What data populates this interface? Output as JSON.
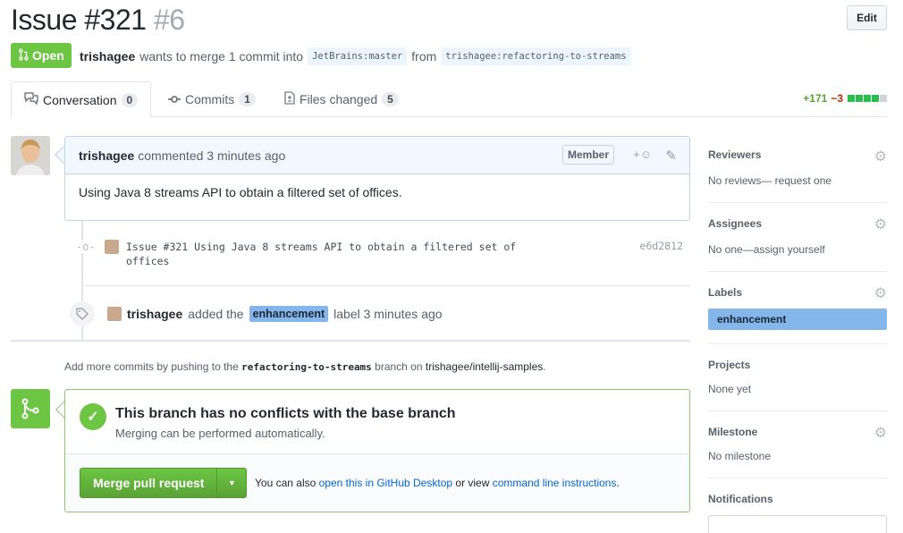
{
  "header": {
    "title": "Issue #321",
    "number": "#6",
    "edit_label": "Edit",
    "state_label": "Open",
    "author": "trishagee",
    "merge_text": "wants to merge 1 commit into",
    "base_ref": "JetBrains:master",
    "from_text": "from",
    "head_ref": "trishagee:refactoring-to-streams"
  },
  "tabs": [
    {
      "label": "Conversation",
      "count": "0",
      "icon": "comment-discussion-icon"
    },
    {
      "label": "Commits",
      "count": "1",
      "icon": "git-commit-icon"
    },
    {
      "label": "Files changed",
      "count": "5",
      "icon": "file-diff-icon"
    }
  ],
  "diffstat": {
    "additions": "+171",
    "deletions": "−3",
    "blocks_green": 4,
    "blocks_gray": 1,
    "colors": {
      "add": "#55a532",
      "del": "#bd2c00"
    }
  },
  "comment": {
    "author": "trishagee",
    "action": "commented 3 minutes ago",
    "badge": "Member",
    "react_label": "+☺",
    "body": "Using Java 8 streams API to obtain a filtered set of offices."
  },
  "commit": {
    "message": "Issue #321 Using Java 8 streams API to obtain a filtered set of offices",
    "sha": "e6d2812"
  },
  "label_event": {
    "author": "trishagee",
    "text_before": "added the",
    "label": "enhancement",
    "text_after": "label 3 minutes ago"
  },
  "hint": {
    "prefix": "Add more commits by pushing to the",
    "branch": "refactoring-to-streams",
    "middle": "branch on",
    "repo": "trishagee/intellij-samples",
    "suffix": "."
  },
  "merge": {
    "title": "This branch has no conflicts with the base branch",
    "subtitle": "Merging can be performed automatically.",
    "button_label": "Merge pull request",
    "alt_prefix": "You can also",
    "alt_link1": "open this in GitHub Desktop",
    "alt_middle": "or view",
    "alt_link2": "command line instructions",
    "alt_suffix": "."
  },
  "sidebar": {
    "reviewers": {
      "heading": "Reviewers",
      "value": "No reviews— request one"
    },
    "assignees": {
      "heading": "Assignees",
      "value": "No one—assign yourself"
    },
    "labels": {
      "heading": "Labels",
      "value": "enhancement"
    },
    "projects": {
      "heading": "Projects",
      "value": "None yet"
    },
    "milestone": {
      "heading": "Milestone",
      "value": "No milestone"
    },
    "notifications": {
      "heading": "Notifications"
    }
  },
  "colors": {
    "open_green": "#6cc644",
    "label_blue": "#84b6eb",
    "link": "#0366d6"
  }
}
